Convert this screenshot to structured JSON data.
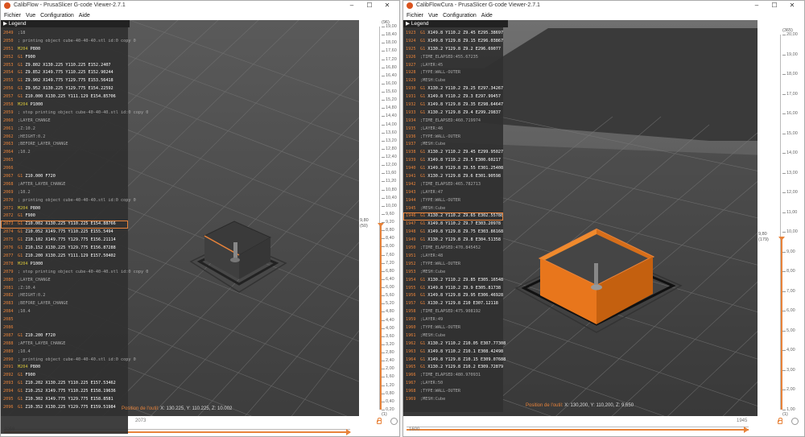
{
  "left_window": {
    "title": "CalibFlow - PrusaSlicer G-code Viewer-2.7.1",
    "menu": [
      "Fichier",
      "Vue",
      "Configuration",
      "Aide"
    ],
    "legend_label": "Legend",
    "gcode_lines": [
      {
        "n": "2049",
        "cmd": "",
        "text": ";18"
      },
      {
        "n": "2050",
        "cmd": "",
        "text": "; printing object cube-40-40-40.stl id:0 copy 0"
      },
      {
        "n": "2051",
        "cmd": "M204",
        "text": " P800"
      },
      {
        "n": "2052",
        "cmd": "G1",
        "text": " F900"
      },
      {
        "n": "2053",
        "cmd": "G1",
        "text": " Z9.802 X130.225 Y110.225 E152.2407"
      },
      {
        "n": "2054",
        "cmd": "G1",
        "text": " Z9.852 X149.775 Y110.225 E152.90244"
      },
      {
        "n": "2055",
        "cmd": "G1",
        "text": " Z9.902 X149.775 Y129.775 E153.56418"
      },
      {
        "n": "2056",
        "cmd": "G1",
        "text": " Z9.952 X130.225 Y129.775 E154.22592"
      },
      {
        "n": "2057",
        "cmd": "G1",
        "text": " Z10.000 X130.225 Y111.129 E154.85706"
      },
      {
        "n": "2058",
        "cmd": "M204",
        "text": " P1000"
      },
      {
        "n": "2059",
        "cmd": "",
        "text": "; stop printing object cube-40-40-40.stl id:0 copy 0"
      },
      {
        "n": "2060",
        "cmd": "",
        "text": ";LAYER_CHANGE"
      },
      {
        "n": "2061",
        "cmd": "",
        "text": ";Z:10.2"
      },
      {
        "n": "2062",
        "cmd": "",
        "text": ";HEIGHT:0.2"
      },
      {
        "n": "2063",
        "cmd": "",
        "text": ";BEFORE_LAYER_CHANGE"
      },
      {
        "n": "2064",
        "cmd": "",
        "text": ";10.2"
      },
      {
        "n": "2065",
        "cmd": "",
        "text": ""
      },
      {
        "n": "2066",
        "cmd": "",
        "text": ""
      },
      {
        "n": "2067",
        "cmd": "G1",
        "text": " Z10.000 F720"
      },
      {
        "n": "2068",
        "cmd": "",
        "text": ";AFTER_LAYER_CHANGE"
      },
      {
        "n": "2069",
        "cmd": "",
        "text": ";10.2"
      },
      {
        "n": "2070",
        "cmd": "",
        "text": "; printing object cube-40-40-40.stl id:0 copy 0"
      },
      {
        "n": "2071",
        "cmd": "M204",
        "text": " P800"
      },
      {
        "n": "2072",
        "cmd": "G1",
        "text": " F900"
      },
      {
        "n": "2073",
        "cmd": "G1",
        "text": " Z10.002 X130.225 Y110.225 E154.88766",
        "hl": true
      },
      {
        "n": "2074",
        "cmd": "G1",
        "text": " Z10.052 X149.775 Y110.225 E155.5494"
      },
      {
        "n": "2075",
        "cmd": "G1",
        "text": " Z10.102 X149.775 Y129.775 E156.21114"
      },
      {
        "n": "2076",
        "cmd": "G1",
        "text": " Z10.152 X130.225 Y129.775 E156.87288"
      },
      {
        "n": "2077",
        "cmd": "G1",
        "text": " Z10.200 X130.225 Y111.129 E157.50402"
      },
      {
        "n": "2078",
        "cmd": "M204",
        "text": " P1000"
      },
      {
        "n": "2079",
        "cmd": "",
        "text": "; stop printing object cube-40-40-40.stl id:0 copy 0"
      },
      {
        "n": "2080",
        "cmd": "",
        "text": ";LAYER_CHANGE"
      },
      {
        "n": "2081",
        "cmd": "",
        "text": ";Z:10.4"
      },
      {
        "n": "2082",
        "cmd": "",
        "text": ";HEIGHT:0.2"
      },
      {
        "n": "2083",
        "cmd": "",
        "text": ";BEFORE_LAYER_CHANGE"
      },
      {
        "n": "2084",
        "cmd": "",
        "text": ";10.4"
      },
      {
        "n": "2085",
        "cmd": "",
        "text": ""
      },
      {
        "n": "2086",
        "cmd": "",
        "text": ""
      },
      {
        "n": "2087",
        "cmd": "G1",
        "text": " Z10.200 F720"
      },
      {
        "n": "2088",
        "cmd": "",
        "text": ";AFTER_LAYER_CHANGE"
      },
      {
        "n": "2089",
        "cmd": "",
        "text": ";10.4"
      },
      {
        "n": "2090",
        "cmd": "",
        "text": "; printing object cube-40-40-40.stl id:0 copy 0"
      },
      {
        "n": "2091",
        "cmd": "M204",
        "text": " P800"
      },
      {
        "n": "2092",
        "cmd": "G1",
        "text": " F900"
      },
      {
        "n": "2093",
        "cmd": "G1",
        "text": " Z10.202 X130.225 Y110.225 E157.53462"
      },
      {
        "n": "2094",
        "cmd": "G1",
        "text": " Z10.252 X149.775 Y110.225 E158.19636"
      },
      {
        "n": "2095",
        "cmd": "G1",
        "text": " Z10.302 X149.775 Y129.775 E158.8581"
      },
      {
        "n": "2096",
        "cmd": "G1",
        "text": " Z10.352 X130.225 Y129.775 E159.51984"
      }
    ],
    "tool_position_label": "Position de l'outil:",
    "tool_position_value": "X: 130.225, Y: 110.225, Z: 10.002",
    "vslider": {
      "ticks": [
        "19,00",
        "18,40",
        "18,00",
        "17,60",
        "17,20",
        "16,80",
        "16,40",
        "16,00",
        "15,60",
        "15,20",
        "14,80",
        "14,40",
        "14,00",
        "13,60",
        "13,20",
        "12,80",
        "12,40",
        "12,00",
        "11,60",
        "11,20",
        "10,80",
        "10,40",
        "10,00",
        "9,60",
        "9,20",
        "8,80",
        "8,40",
        "8,00",
        "7,60",
        "7,20",
        "6,80",
        "6,40",
        "6,00",
        "5,60",
        "5,20",
        "4,80",
        "4,40",
        "4,00",
        "3,60",
        "3,20",
        "2,80",
        "2,40",
        "2,00",
        "1,60",
        "1,20",
        "0,80",
        "0,40",
        "0,20"
      ],
      "current_value": "9,80",
      "current_layer": "(50)",
      "top_layer": "(96)",
      "bottom_label": "(1)"
    },
    "hslider": {
      "left": "2056",
      "marker": "2073"
    }
  },
  "right_window": {
    "title": "CalibFlowCura - PrusaSlicer G-code Viewer-2.7.1",
    "menu": [
      "Fichier",
      "Vue",
      "Configuration",
      "Aide"
    ],
    "legend_label": "Legend",
    "gcode_lines": [
      {
        "n": "1923",
        "cmd": "G1",
        "text": " X149.8 Y110.2 Z9.45 E295.38697"
      },
      {
        "n": "1924",
        "cmd": "G1",
        "text": " X149.8 Y129.8 Z9.15 E296.03867"
      },
      {
        "n": "1925",
        "cmd": "G1",
        "text": " X130.2 Y129.8 Z9.2 E296.69077"
      },
      {
        "n": "1926",
        "cmd": "",
        "text": ";TIME_ELAPSED:455.67235"
      },
      {
        "n": "1927",
        "cmd": "",
        "text": ";LAYER:45"
      },
      {
        "n": "1928",
        "cmd": "",
        "text": ";TYPE:WALL-OUTER"
      },
      {
        "n": "1929",
        "cmd": "",
        "text": ";MESH:Cube"
      },
      {
        "n": "1930",
        "cmd": "G1",
        "text": " X130.2 Y110.2 Z9.25 E297.34267"
      },
      {
        "n": "1931",
        "cmd": "G1",
        "text": " X149.8 Y110.2 Z9.3 E297.99457"
      },
      {
        "n": "1932",
        "cmd": "G1",
        "text": " X149.8 Y129.8 Z9.35 E298.64647"
      },
      {
        "n": "1933",
        "cmd": "G1",
        "text": " X130.2 Y129.8 Z9.4 E299.29837"
      },
      {
        "n": "1934",
        "cmd": "",
        "text": ";TIME_ELAPSED:460.719974"
      },
      {
        "n": "1935",
        "cmd": "",
        "text": ";LAYER:46"
      },
      {
        "n": "1936",
        "cmd": "",
        "text": ";TYPE:WALL-OUTER"
      },
      {
        "n": "1937",
        "cmd": "",
        "text": ";MESH:Cube"
      },
      {
        "n": "1938",
        "cmd": "G1",
        "text": " X130.2 Y110.2 Z9.45 E299.95027"
      },
      {
        "n": "1939",
        "cmd": "G1",
        "text": " X149.8 Y110.2 Z9.5 E300.60217"
      },
      {
        "n": "1940",
        "cmd": "G1",
        "text": " X149.8 Y129.8 Z9.55 E301.25408"
      },
      {
        "n": "1941",
        "cmd": "G1",
        "text": " X130.2 Y129.8 Z9.6 E301.90598"
      },
      {
        "n": "1942",
        "cmd": "",
        "text": ";TIME_ELAPSED:465.782713"
      },
      {
        "n": "1943",
        "cmd": "",
        "text": ";LAYER:47"
      },
      {
        "n": "1944",
        "cmd": "",
        "text": ";TYPE:WALL-OUTER"
      },
      {
        "n": "1945",
        "cmd": "",
        "text": ";MESH:Cube"
      },
      {
        "n": "1946",
        "cmd": "G1",
        "text": " X130.2 Y110.2 Z9.65 E302.55788",
        "hl": true
      },
      {
        "n": "1947",
        "cmd": "G1",
        "text": " X149.8 Y110.2 Z9.7 E303.20978"
      },
      {
        "n": "1948",
        "cmd": "G1",
        "text": " X149.8 Y129.8 Z9.75 E303.86168"
      },
      {
        "n": "1949",
        "cmd": "G1",
        "text": " X130.2 Y129.8 Z9.8 E304.51358"
      },
      {
        "n": "1950",
        "cmd": "",
        "text": ";TIME_ELAPSED:470.845452"
      },
      {
        "n": "1951",
        "cmd": "",
        "text": ";LAYER:48"
      },
      {
        "n": "1952",
        "cmd": "",
        "text": ";TYPE:WALL-OUTER"
      },
      {
        "n": "1953",
        "cmd": "",
        "text": ";MESH:Cube"
      },
      {
        "n": "1954",
        "cmd": "G1",
        "text": " X130.2 Y110.2 Z9.85 E305.16548"
      },
      {
        "n": "1955",
        "cmd": "G1",
        "text": " X149.8 Y110.2 Z9.9 E305.81738"
      },
      {
        "n": "1956",
        "cmd": "G1",
        "text": " X149.8 Y129.8 Z9.95 E306.46928"
      },
      {
        "n": "1957",
        "cmd": "G1",
        "text": " X130.2 Y129.8 Z10 E307.12118"
      },
      {
        "n": "1958",
        "cmd": "",
        "text": ";TIME_ELAPSED:475.908192"
      },
      {
        "n": "1959",
        "cmd": "",
        "text": ";LAYER:49"
      },
      {
        "n": "1960",
        "cmd": "",
        "text": ";TYPE:WALL-OUTER"
      },
      {
        "n": "1961",
        "cmd": "",
        "text": ";MESH:Cube"
      },
      {
        "n": "1962",
        "cmd": "G1",
        "text": " X130.2 Y110.2 Z10.05 E307.77308"
      },
      {
        "n": "1963",
        "cmd": "G1",
        "text": " X149.8 Y110.2 Z10.1 E308.42498"
      },
      {
        "n": "1964",
        "cmd": "G1",
        "text": " X149.8 Y129.8 Z10.15 E309.07688"
      },
      {
        "n": "1965",
        "cmd": "G1",
        "text": " X130.2 Y129.8 Z10.2 E309.72879"
      },
      {
        "n": "1966",
        "cmd": "",
        "text": ";TIME_ELAPSED:480.970931"
      },
      {
        "n": "1967",
        "cmd": "",
        "text": ";LAYER:50"
      },
      {
        "n": "1968",
        "cmd": "",
        "text": ";TYPE:WALL-OUTER"
      },
      {
        "n": "1969",
        "cmd": "",
        "text": ";MESH:Cube"
      }
    ],
    "tool_position_label": "Position de l'outil:",
    "tool_position_value": "X: 130,200, Y: 110,200, Z: 9,650",
    "vslider": {
      "ticks": [
        "20,00",
        "19,00",
        "18,00",
        "17,00",
        "16,00",
        "15,00",
        "14,00",
        "13,00",
        "12,00",
        "11,00",
        "10,00",
        "9,00",
        "8,00",
        "7,00",
        "6,00",
        "5,00",
        "4,00",
        "3,00",
        "2,00",
        "1,00"
      ],
      "current_value": "9,80",
      "current_layer": "(179)",
      "top_layer": "(365)",
      "bottom_label": "(1)"
    },
    "hslider": {
      "left": "1600",
      "marker": "1945"
    }
  },
  "colors": {
    "accent": "#e8833a",
    "viewport_bg": "#4a4a4a",
    "panel_bg": "#303030"
  }
}
